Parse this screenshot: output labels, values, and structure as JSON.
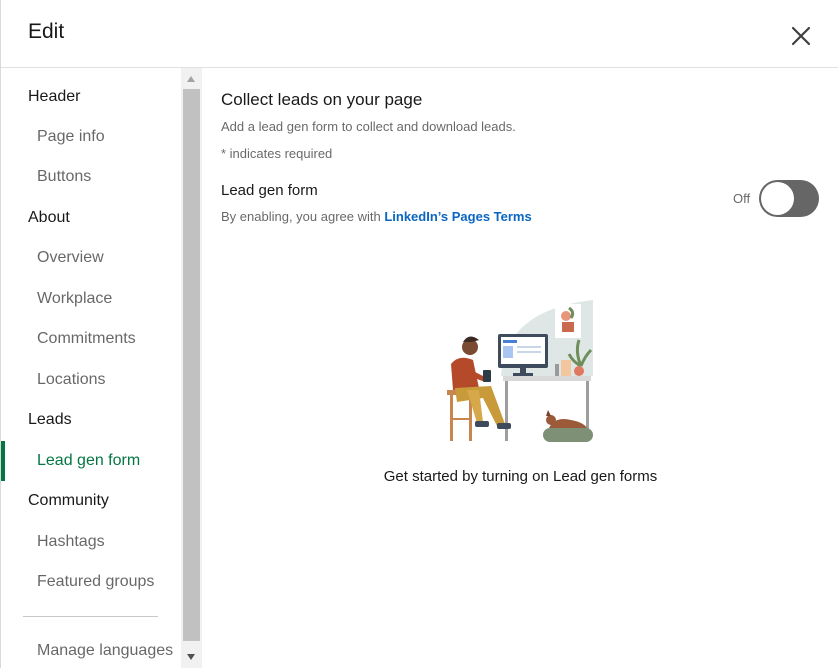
{
  "dialog": {
    "title": "Edit"
  },
  "sidebar": {
    "sections": [
      {
        "label": "Header",
        "items": [
          "Page info",
          "Buttons"
        ]
      },
      {
        "label": "About",
        "items": [
          "Overview",
          "Workplace",
          "Commitments",
          "Locations"
        ]
      },
      {
        "label": "Leads",
        "items": [
          "Lead gen form"
        ]
      },
      {
        "label": "Community",
        "items": [
          "Hashtags",
          "Featured groups"
        ]
      }
    ],
    "active_item": "Lead gen form",
    "footer_item": "Manage languages"
  },
  "main": {
    "heading": "Collect leads on your page",
    "description": "Add a lead gen form to collect and download leads.",
    "required_note": "* indicates required",
    "field_label": "Lead gen form",
    "terms_prefix": "By enabling, you agree with ",
    "terms_link": "LinkedIn’s Pages Terms",
    "toggle_state": "Off",
    "toggle_on": false,
    "empty_state_message": "Get started by turning on Lead gen forms"
  },
  "colors": {
    "active_accent": "#057642",
    "link": "#0a66c2",
    "toggle_off": "#666666"
  },
  "icons": {
    "close": "close-icon",
    "illustration": "person-at-desk-illustration"
  }
}
